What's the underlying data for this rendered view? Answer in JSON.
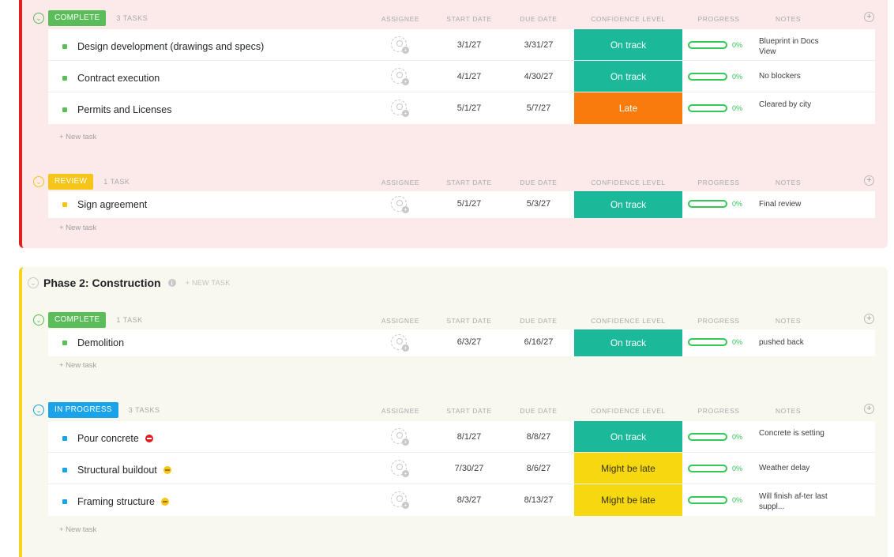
{
  "columns": {
    "assignee": "ASSIGNEE",
    "start": "START DATE",
    "due": "DUE DATE",
    "confidence": "CONFIDENCE LEVEL",
    "progress": "PROGRESS",
    "notes": "NOTES"
  },
  "new_task_label": "+ New task",
  "colors": {
    "complete": "#5bbd5a",
    "review": "#f5c518",
    "in_progress": "#1aa3e8",
    "on_track": "#1bb99a",
    "late": "#f97b0c",
    "might_be_late": "#f6d811",
    "phase1_border": "#e02020",
    "phase2_border": "#f6d21b"
  },
  "phase2": {
    "title": "Phase 2: Construction",
    "new_task": "+ NEW TASK"
  },
  "groups": [
    {
      "status": "COMPLETE",
      "count": "3 TASKS",
      "tasks": [
        {
          "name": "Design development (drawings and specs)",
          "start": "3/1/27",
          "due": "3/31/27",
          "confidence": "On track",
          "progress": "0%",
          "progress_value": 0,
          "notes": "Blueprint in Docs View"
        },
        {
          "name": "Contract execution",
          "start": "4/1/27",
          "due": "4/30/27",
          "confidence": "On track",
          "progress": "0%",
          "progress_value": 0,
          "notes": "No blockers"
        },
        {
          "name": "Permits and Licenses",
          "start": "5/1/27",
          "due": "5/7/27",
          "confidence": "Late",
          "progress": "0%",
          "progress_value": 0,
          "notes": "Cleared by city"
        }
      ]
    },
    {
      "status": "REVIEW",
      "count": "1 TASK",
      "tasks": [
        {
          "name": "Sign agreement",
          "start": "5/1/27",
          "due": "5/3/27",
          "confidence": "On track",
          "progress": "0%",
          "progress_value": 0,
          "notes": "Final review"
        }
      ]
    },
    {
      "status": "COMPLETE",
      "count": "1 TASK",
      "tasks": [
        {
          "name": "Demolition",
          "start": "6/3/27",
          "due": "6/16/27",
          "confidence": "On track",
          "progress": "0%",
          "progress_value": 0,
          "notes": "pushed back"
        }
      ]
    },
    {
      "status": "IN PROGRESS",
      "count": "3 TASKS",
      "tasks": [
        {
          "name": "Pour concrete",
          "icon": "stop-icon",
          "start": "8/1/27",
          "due": "8/8/27",
          "confidence": "On track",
          "progress": "0%",
          "progress_value": 0,
          "notes": "Concrete is setting"
        },
        {
          "name": "Structural buildout",
          "icon": "warning-icon",
          "start": "7/30/27",
          "due": "8/6/27",
          "confidence": "Might be late",
          "progress": "0%",
          "progress_value": 0,
          "notes": "Weather delay"
        },
        {
          "name": "Framing structure",
          "icon": "warning-icon",
          "start": "8/3/27",
          "due": "8/13/27",
          "confidence": "Might be late",
          "progress": "0%",
          "progress_value": 0,
          "notes": "Will finish af-ter last suppl..."
        }
      ]
    }
  ]
}
